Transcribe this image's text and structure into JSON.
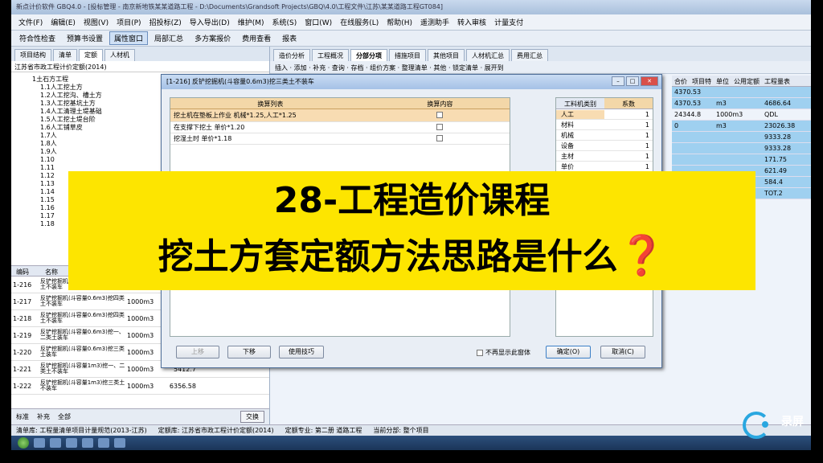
{
  "app": {
    "title": "新点计价软件 GBQ4.0 - [投标管理 - 南京新地铁某某道路工程 - D:\\Documents\\Grandsoft Projects\\GBQ\\4.0\\工程文件\\江苏\\某某道路工程GT084]"
  },
  "menu": [
    "文件(F)",
    "编辑(E)",
    "视图(V)",
    "项目(P)",
    "招投标(Z)",
    "导入导出(D)",
    "维护(M)",
    "系统(S)",
    "窗口(W)",
    "在线服务(L)",
    "帮助(H)",
    "遥测助手",
    "转入审核",
    "计量支付"
  ],
  "toolbar": [
    "符合性检查",
    "预算书设置",
    "属性窗口",
    "局部汇总",
    "多方案报价",
    "费用查看",
    "报表"
  ],
  "left": {
    "tabs": [
      "项目结构",
      "清单",
      "定额",
      "人材机"
    ],
    "header": "江苏省市政工程计价定额(2014)",
    "tree": [
      "1土石方工程",
      "1.1人工挖土方",
      "1.2人工挖沟、槽土方",
      "1.3人工挖基坑土方",
      "1.4人工清理土堤基础",
      "1.5人工挖土堤台阶",
      "1.6人工铺草皮",
      "1.7人",
      "1.8人",
      "1.9人",
      "1.10",
      "1.11",
      "1.12",
      "1.13",
      "1.14",
      "1.15",
      "1.16",
      "1.17",
      "1.18"
    ],
    "code_header": [
      "编码",
      "名称",
      "单位",
      "单价"
    ],
    "rows": [
      {
        "code": "1-216",
        "name": "反铲挖掘机(斗容量0.6m3)挖三类土不装车",
        "unit": "1000m3",
        "price": ""
      },
      {
        "code": "1-217",
        "name": "反铲挖掘机(斗容量0.6m3)挖四类土不装车",
        "unit": "1000m3",
        "price": ""
      },
      {
        "code": "1-218",
        "name": "反铲挖掘机(斗容量0.6m3)挖四类土不装车",
        "unit": "1000m3",
        "price": ""
      },
      {
        "code": "1-219",
        "name": "反铲挖掘机(斗容量0.6m3)挖一、二类土装车",
        "unit": "1000m3",
        "price": ""
      },
      {
        "code": "1-220",
        "name": "反铲挖掘机(斗容量0.6m3)挖三类土装车",
        "unit": "1000m3",
        "price": ""
      },
      {
        "code": "1-221",
        "name": "反铲挖掘机(斗容量1m3)挖一、二类土不装车",
        "unit": "1000m3",
        "price": "5412.7"
      },
      {
        "code": "1-222",
        "name": "反铲挖掘机(斗容量1m3)挖三类土不装车",
        "unit": "1000m3",
        "price": "6356.58"
      }
    ],
    "filter": [
      "标准",
      "补充",
      "全部"
    ],
    "swap_button": "交换"
  },
  "right": {
    "tabs": [
      "造价分析",
      "工程概况",
      "分部分项",
      "措施项目",
      "其他项目",
      "人材机汇总",
      "费用汇总"
    ],
    "toolbar_text": "插入 · 添加 · 补充 · 查询 · 存档 · 组价方案 · 整理清单 · 其他 · 锁定清单 · 展开到",
    "grid_header": [
      "合价",
      "项目特",
      "单位",
      "公用定额",
      "工程量表"
    ],
    "grid_rows": [
      {
        "a": "4370.53",
        "b": "",
        "c": "",
        "d": "",
        "e": "",
        "blue": true
      },
      {
        "a": "4370.53",
        "b": "",
        "c": "m3",
        "d": "",
        "e": "4686.64",
        "blue": true
      },
      {
        "a": "24344.8",
        "b": "",
        "c": "1000m3",
        "d": "",
        "e": "QDL",
        "blue": false
      },
      {
        "a": "0",
        "b": "",
        "c": "m3",
        "d": "",
        "e": "23026.38",
        "blue": true
      },
      {
        "a": "",
        "b": "",
        "c": "",
        "d": "",
        "e": "9333.28",
        "blue": true
      },
      {
        "a": "",
        "b": "",
        "c": "",
        "d": "",
        "e": "9333.28",
        "blue": true
      },
      {
        "a": "",
        "b": "",
        "c": "",
        "d": "",
        "e": "171.75",
        "blue": true
      },
      {
        "a": "",
        "b": "",
        "c": "",
        "d": "",
        "e": "621.49",
        "blue": true
      },
      {
        "a": "",
        "b": "",
        "c": "",
        "d": "",
        "e": "584.4",
        "blue": true
      },
      {
        "a": "",
        "b": "",
        "c": "",
        "d": "",
        "e": "TOT.2",
        "blue": true
      }
    ]
  },
  "status": [
    "清单库: 工程量清单项目计量规范(2013-江苏)",
    "定额库: 江苏省市政工程计价定额(2014)",
    "定额专业: 第二册 道路工程",
    "当前分部: 整个项目"
  ],
  "dialog": {
    "title": "[1-216] 反铲挖掘机(斗容量0.6m3)挖三类土不装车",
    "col_list": "换算列表",
    "col_content": "换算内容",
    "rows": [
      {
        "text": "挖土机在垫板上作业 机械*1.25,人工*1.25",
        "selected": true
      },
      {
        "text": "在支撑下挖土 单价*1.20",
        "selected": false
      },
      {
        "text": "挖湿土时 单价*1.18",
        "selected": false
      }
    ],
    "side_header": [
      "工料机类别",
      "系数"
    ],
    "side_rows": [
      {
        "name": "人工",
        "value": "1"
      },
      {
        "name": "材料",
        "value": "1"
      },
      {
        "name": "机械",
        "value": "1"
      },
      {
        "name": "设备",
        "value": "1"
      },
      {
        "name": "主材",
        "value": "1"
      },
      {
        "name": "单价",
        "value": "1"
      }
    ],
    "buttons": {
      "up": "上移",
      "down": "下移",
      "tips": "使用技巧",
      "ok": "确定(O)",
      "cancel": "取消(C)"
    },
    "no_show": "不再显示此窗体"
  },
  "overlay": {
    "line1": "28-工程造价课程",
    "line2": "挖土方套定额方法思路是什么",
    "qmark": "❓"
  },
  "watermark": {
    "text": "录屏"
  }
}
